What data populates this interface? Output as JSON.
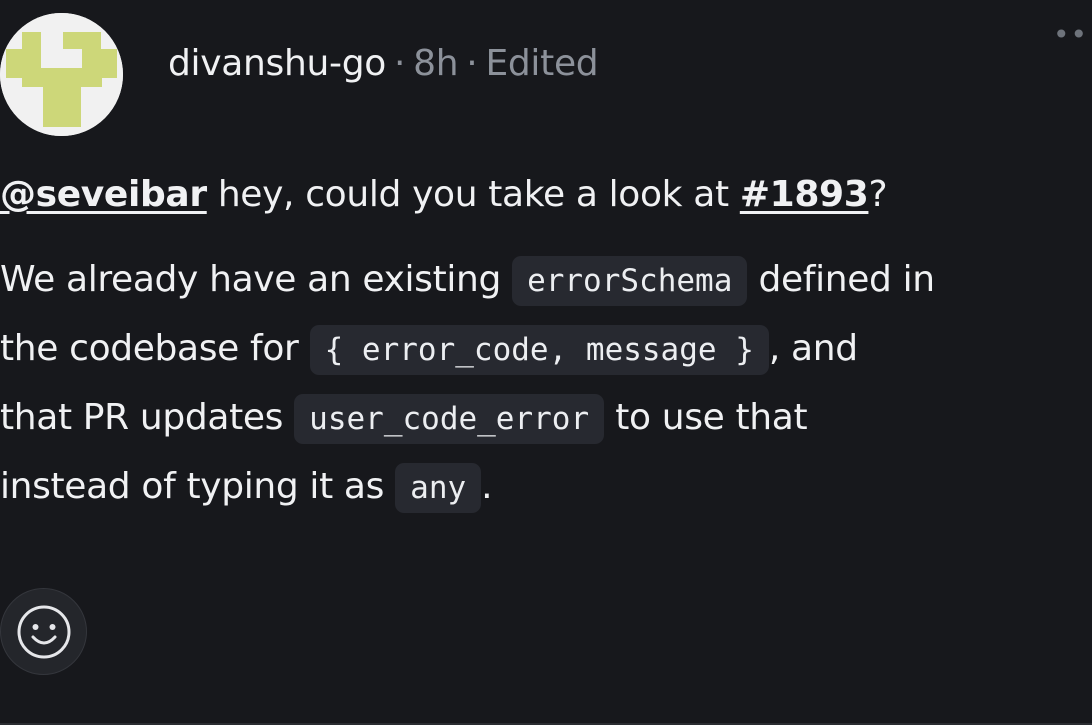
{
  "comment": {
    "author": "divanshu-go",
    "separator": "·",
    "time": "8h",
    "edited_label": "Edited",
    "more_label": "••",
    "paragraph1": {
      "mention": "@seveibar",
      "text_before_issue": " hey, could you take a look at ",
      "issue_link": "#1893",
      "text_after_issue": "?"
    },
    "paragraph2": {
      "t1": "We already have an existing ",
      "c1": "errorSchema",
      "t2": " defined in",
      "t3": "the codebase for ",
      "c2": "{ error_code, message }",
      "t4": ", and",
      "t5": "that PR updates ",
      "c3": "user_code_error",
      "t6": " to use that",
      "t7": "instead of typing it as ",
      "c4": "any",
      "t8": "."
    }
  },
  "icons": {
    "avatar": "identicon-avatar",
    "reaction": "smiley-icon",
    "more": "more-options-icon"
  },
  "colors": {
    "background": "#17181c",
    "text": "#f0f1f3",
    "muted": "#8c919a",
    "code_bg": "#272930",
    "identicon": "#cdd779"
  }
}
